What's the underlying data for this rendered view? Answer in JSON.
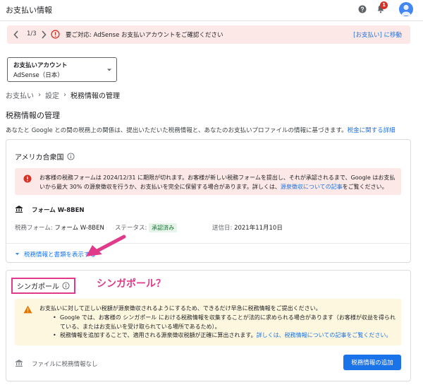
{
  "header": {
    "title": "お支払い情報",
    "notification_count": "1",
    "icons": {
      "help": "help-icon",
      "bell": "bell-icon",
      "avatar": "avatar"
    }
  },
  "banner": {
    "pager": "1/3",
    "text": "要ご対応: AdSense お支払いアカウントをご確認ください",
    "action": "[お支払い] に移動"
  },
  "account": {
    "label": "お支払いアカウント",
    "value": "AdSense（日本）"
  },
  "breadcrumb": {
    "items": [
      "お支払い",
      "設定"
    ],
    "current": "税務情報の管理"
  },
  "page": {
    "title": "税務情報の管理",
    "description": "あなたと Google との間の税務上の関係は、提出いただいた税務情報と、あなたのお支払いプロファイルの情報に基づきます。",
    "description_link": "税金に関する詳細"
  },
  "us_section": {
    "title": "アメリカ合衆国",
    "error_text": "お客様の税務フォームは 2024/12/31 に期限が切れます。お客様が新しい税務フォームを提出し、それが承認されるまで、Google はお支払いから最大 30% の源泉徴収を行うか、お支払いを完全に保留する場合があります。詳しくは、",
    "error_link": "源泉徴収についての記事",
    "error_suffix": "をご覧ください。",
    "form_name": "フォーム W-8BEN",
    "form_label": "税務フォーム:",
    "form_value": "フォーム W-8BEN",
    "status_label": "ステータス:",
    "status_value": "承認済み",
    "sent_label": "送信日:",
    "sent_value": "2021年11月10日",
    "expand_label": "税務情報と書類を表示する"
  },
  "sg_section": {
    "title": "シンガポール",
    "annotation": "シンガポール？",
    "warn_intro": "お支払いに対して正しい税額が源泉徴収されるようにするため、できるだけ早急に税務情報をご提出ください。",
    "bullet1": "Google では、お客様の シンガポール における税務情報を収集することが法的に求められる場合があります（お客様が収益を得られている、またはお支払いを受け取られている場所であるため）。",
    "bullet2_text": "税務情報を追加することで、適用される源泉徴収税額が正確に算出されます。",
    "bullet2_link": "詳しくは、税務情報についての記事をご覧ください。",
    "no_info": "ファイルに税務情報なし",
    "add_button": "税務情報の追加"
  },
  "colors": {
    "accent": "#1a73e8",
    "error_bg": "#fce8e6",
    "error": "#d93025",
    "warn_bg": "#fef7e0",
    "warn": "#f29900",
    "annotation": "#e03a8b",
    "success_bg": "#e6f4ea",
    "success": "#137333"
  }
}
